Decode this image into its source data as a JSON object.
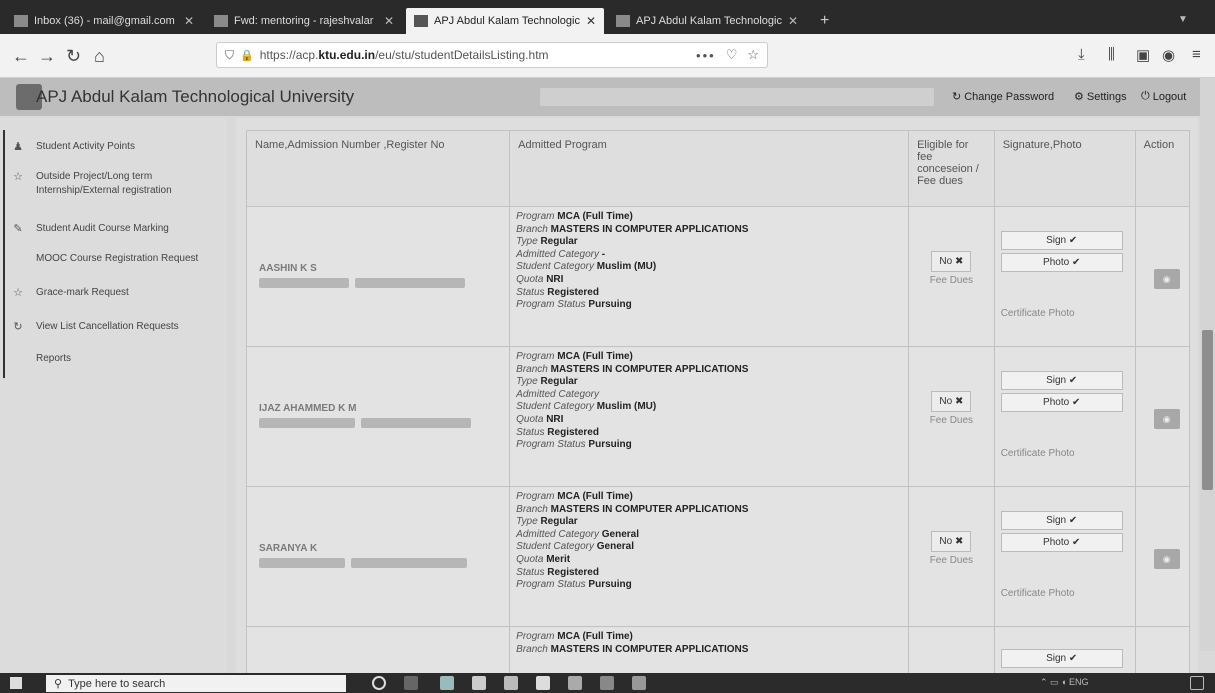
{
  "browser": {
    "tabs": [
      {
        "label": "Inbox (36) - mail@gmail.com",
        "active": false
      },
      {
        "label": "Fwd: mentoring - rajeshvalar",
        "active": false
      },
      {
        "label": "APJ Abdul Kalam Technologic",
        "active": true
      },
      {
        "label": "APJ Abdul Kalam Technologic",
        "active": false
      }
    ],
    "new_tab": "+",
    "url_prefix": "https://acp.",
    "url_domain": "ktu.edu.in",
    "url_path": "/eu/stu/studentDetailsListing.htm",
    "url_menu": "•••"
  },
  "header": {
    "title": "APJ Abdul Kalam Technological University",
    "change_password": "Change Password",
    "settings": "Settings",
    "logout": "Logout"
  },
  "sidebar": {
    "items": [
      {
        "label": "Student Activity Points",
        "icon": "user-icon"
      },
      {
        "label": "Outside Project/Long term Internship/External registration",
        "icon": "star-icon"
      },
      {
        "label": "Student Audit Course Marking",
        "icon": "pencil-icon"
      },
      {
        "label": "MOOC Course Registration Request",
        "icon": ""
      },
      {
        "label": "Grace-mark Request",
        "icon": "star-icon"
      },
      {
        "label": "View List Cancellation Requests",
        "icon": "refresh-icon"
      },
      {
        "label": "Reports",
        "icon": ""
      }
    ]
  },
  "table": {
    "headers": {
      "name": "Name,Admission Number ,Register No",
      "program": "Admitted Program",
      "eligible": "Eligible for fee conceseion / Fee dues",
      "signature": "Signature,Photo",
      "action": "Action"
    },
    "labels": {
      "program": "Program",
      "branch": "Branch",
      "type": "Type",
      "admitted_category": "Admitted Category",
      "student_category": "Student Category",
      "quota": "Quota",
      "status": "Status",
      "program_status": "Program Status",
      "no": "No ✖",
      "fee_dues": "Fee Dues",
      "sign": "Sign ✔",
      "photo": "Photo ✔",
      "certificate_photo": "Certificate Photo"
    },
    "rows": [
      {
        "name": "AASHIN K S",
        "program": "MCA (Full Time)",
        "branch": "MASTERS IN COMPUTER APPLICATIONS",
        "type": "Regular",
        "admitted_category": "-",
        "student_category": "Muslim (MU)",
        "quota": "NRI",
        "status": "Registered",
        "program_status": "Pursuing"
      },
      {
        "name": "IJAZ AHAMMED K M",
        "program": "MCA (Full Time)",
        "branch": "MASTERS IN COMPUTER APPLICATIONS",
        "type": "Regular",
        "admitted_category": "",
        "student_category": "Muslim (MU)",
        "quota": "NRI",
        "status": "Registered",
        "program_status": "Pursuing"
      },
      {
        "name": "SARANYA K",
        "program": "MCA (Full Time)",
        "branch": "MASTERS IN COMPUTER APPLICATIONS",
        "type": "Regular",
        "admitted_category": "General",
        "student_category": "General",
        "quota": "Merit",
        "status": "Registered",
        "program_status": "Pursuing"
      }
    ],
    "partial_row": {
      "program": "MCA (Full Time)",
      "branch": "MASTERS IN COMPUTER APPLICATIONS",
      "sign": "Sign ✔"
    }
  },
  "taskbar": {
    "search_placeholder": "Type here to search",
    "tray_lang": "ENG"
  }
}
